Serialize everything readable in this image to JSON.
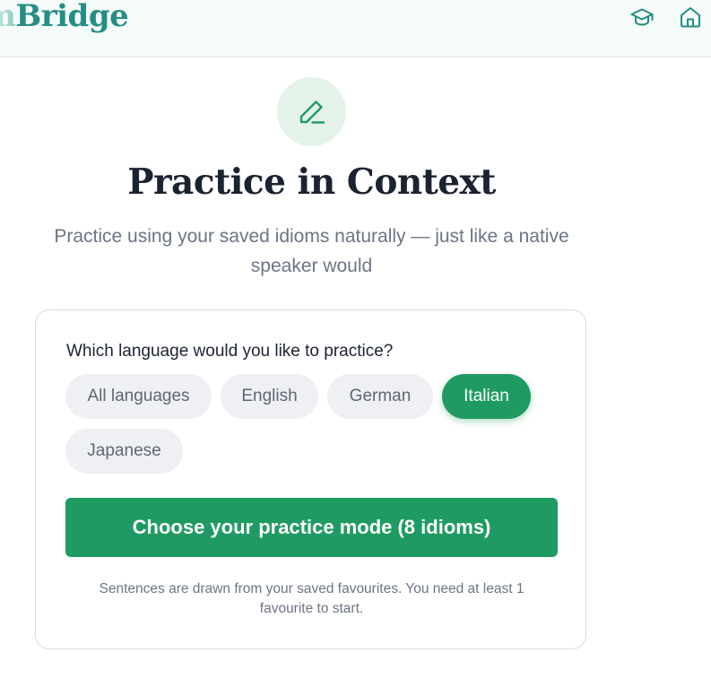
{
  "header": {
    "brand_faded": "m",
    "brand_main": "Bridge",
    "icons": [
      "graduation-cap-icon",
      "home-icon"
    ]
  },
  "hero": {
    "icon": "pencil-icon",
    "title": "Practice in Context",
    "subtitle": "Practice using your saved idioms naturally — just like a native speaker would"
  },
  "card": {
    "question": "Which language would you like to practice?",
    "languages": [
      {
        "label": "All languages",
        "selected": false
      },
      {
        "label": "English",
        "selected": false
      },
      {
        "label": "German",
        "selected": false
      },
      {
        "label": "Italian",
        "selected": true
      },
      {
        "label": "Japanese",
        "selected": false
      }
    ],
    "cta_label": "Choose your practice mode (8 idioms)",
    "footnote": "Sentences are drawn from your saved favourites. You need at least 1 favourite to start."
  },
  "colors": {
    "accent": "#1f9b62",
    "brand": "#258d84",
    "hero_bg": "#e4f2ea",
    "chip_bg": "#eff0f3",
    "title": "#1b2230",
    "muted_text": "#6d7584"
  }
}
